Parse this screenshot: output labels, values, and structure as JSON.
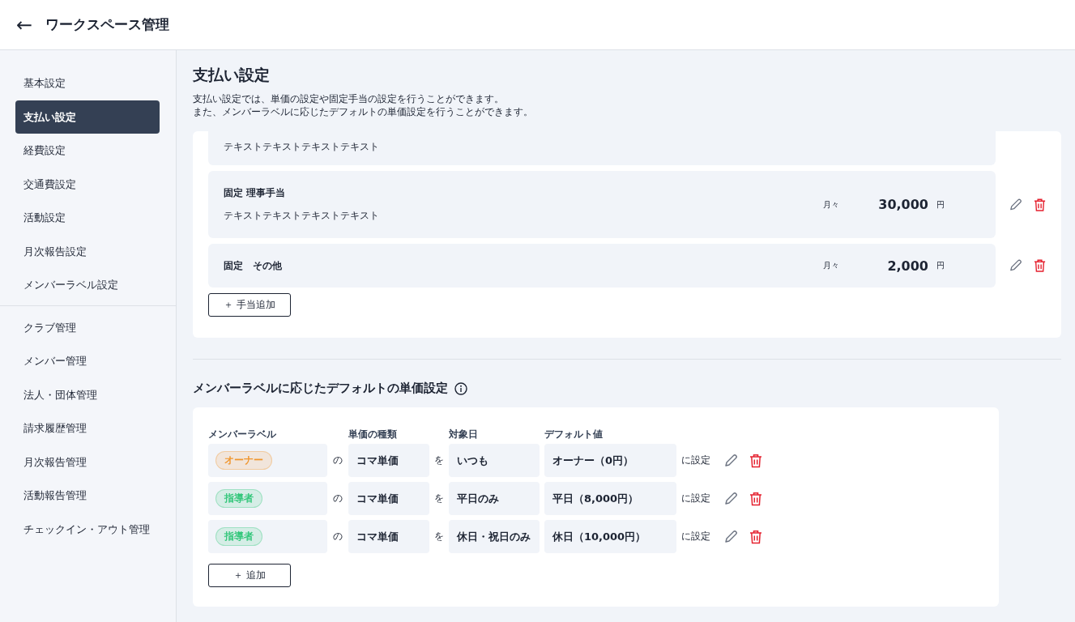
{
  "header": {
    "back": "←",
    "title": "ワークスペース管理"
  },
  "sidebar": {
    "groups": [
      [
        {
          "label": "基本設定",
          "selected": false
        },
        {
          "label": "支払い設定",
          "selected": true
        },
        {
          "label": "経費設定",
          "selected": false
        },
        {
          "label": "交通費設定",
          "selected": false
        },
        {
          "label": "活動設定",
          "selected": false
        },
        {
          "label": "月次報告設定",
          "selected": false
        },
        {
          "label": "メンバーラベル設定",
          "selected": false
        }
      ],
      [
        {
          "label": "クラブ管理",
          "selected": false
        },
        {
          "label": "メンバー管理",
          "selected": false
        },
        {
          "label": "法人・団体管理",
          "selected": false
        },
        {
          "label": "請求履歴管理",
          "selected": false
        },
        {
          "label": "月次報告管理",
          "selected": false
        },
        {
          "label": "活動報告管理",
          "selected": false
        },
        {
          "label": "チェックイン・アウト管理",
          "selected": false
        }
      ]
    ]
  },
  "page": {
    "title": "支払い設定",
    "description": [
      "支払い設定では、単価の設定や固定手当の設定を行うことができます。",
      "また、メンバーラベルに応じたデフォルトの単価設定を行うことができます。"
    ]
  },
  "allowances": {
    "items": [
      {
        "description": "テキストテキストテキストテキスト"
      },
      {
        "name": "固定 理事手当",
        "description": "テキストテキストテキストテキスト",
        "period": "月々",
        "amount": "30,000",
        "unit": "円"
      },
      {
        "name": "固定　その他",
        "period": "月々",
        "amount": "2,000",
        "unit": "円"
      }
    ],
    "add_button": "＋ 手当追加"
  },
  "label_defaults": {
    "title": "メンバーラベルに応じたデフォルトの単価設定",
    "columns": [
      "メンバーラベル",
      "単価の種類",
      "対象日",
      "デフォルト値"
    ],
    "rows": [
      {
        "label": "オーナー",
        "color": "#f0962e",
        "of": "の",
        "price_type": "コマ単価",
        "wo": "を",
        "day": "いつも",
        "value": "オーナー（0円）",
        "suffix": "に設定"
      },
      {
        "label": "指導者",
        "color": "#34c77b",
        "of": "の",
        "price_type": "コマ単価",
        "wo": "を",
        "day": "平日のみ",
        "value": "平日（8,000円）",
        "suffix": "に設定"
      },
      {
        "label": "指導者",
        "color": "#34c77b",
        "of": "の",
        "price_type": "コマ単価",
        "wo": "を",
        "day": "休日・祝日のみ",
        "value": "休日（10,000円）",
        "suffix": "に設定"
      }
    ],
    "add_button": "＋ 追加"
  }
}
